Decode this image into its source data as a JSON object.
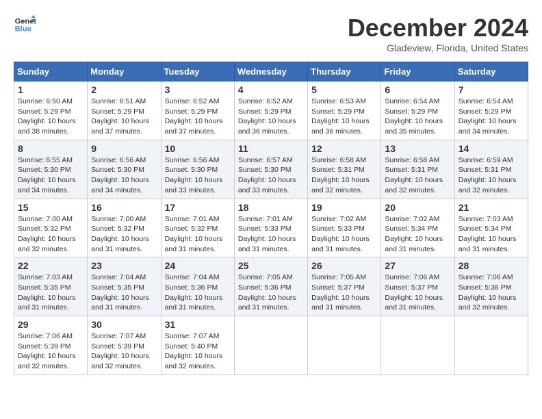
{
  "logo": {
    "line1": "General",
    "line2": "Blue"
  },
  "title": "December 2024",
  "location": "Gladeview, Florida, United States",
  "days_of_week": [
    "Sunday",
    "Monday",
    "Tuesday",
    "Wednesday",
    "Thursday",
    "Friday",
    "Saturday"
  ],
  "weeks": [
    [
      {
        "day": 1,
        "sunrise": "6:50 AM",
        "sunset": "5:29 PM",
        "daylight": "10 hours and 38 minutes."
      },
      {
        "day": 2,
        "sunrise": "6:51 AM",
        "sunset": "5:29 PM",
        "daylight": "10 hours and 37 minutes."
      },
      {
        "day": 3,
        "sunrise": "6:52 AM",
        "sunset": "5:29 PM",
        "daylight": "10 hours and 37 minutes."
      },
      {
        "day": 4,
        "sunrise": "6:52 AM",
        "sunset": "5:29 PM",
        "daylight": "10 hours and 36 minutes."
      },
      {
        "day": 5,
        "sunrise": "6:53 AM",
        "sunset": "5:29 PM",
        "daylight": "10 hours and 36 minutes."
      },
      {
        "day": 6,
        "sunrise": "6:54 AM",
        "sunset": "5:29 PM",
        "daylight": "10 hours and 35 minutes."
      },
      {
        "day": 7,
        "sunrise": "6:54 AM",
        "sunset": "5:29 PM",
        "daylight": "10 hours and 34 minutes."
      }
    ],
    [
      {
        "day": 8,
        "sunrise": "6:55 AM",
        "sunset": "5:30 PM",
        "daylight": "10 hours and 34 minutes."
      },
      {
        "day": 9,
        "sunrise": "6:56 AM",
        "sunset": "5:30 PM",
        "daylight": "10 hours and 34 minutes."
      },
      {
        "day": 10,
        "sunrise": "6:56 AM",
        "sunset": "5:30 PM",
        "daylight": "10 hours and 33 minutes."
      },
      {
        "day": 11,
        "sunrise": "6:57 AM",
        "sunset": "5:30 PM",
        "daylight": "10 hours and 33 minutes."
      },
      {
        "day": 12,
        "sunrise": "6:58 AM",
        "sunset": "5:31 PM",
        "daylight": "10 hours and 32 minutes."
      },
      {
        "day": 13,
        "sunrise": "6:58 AM",
        "sunset": "5:31 PM",
        "daylight": "10 hours and 32 minutes."
      },
      {
        "day": 14,
        "sunrise": "6:59 AM",
        "sunset": "5:31 PM",
        "daylight": "10 hours and 32 minutes."
      }
    ],
    [
      {
        "day": 15,
        "sunrise": "7:00 AM",
        "sunset": "5:32 PM",
        "daylight": "10 hours and 32 minutes."
      },
      {
        "day": 16,
        "sunrise": "7:00 AM",
        "sunset": "5:32 PM",
        "daylight": "10 hours and 31 minutes."
      },
      {
        "day": 17,
        "sunrise": "7:01 AM",
        "sunset": "5:32 PM",
        "daylight": "10 hours and 31 minutes."
      },
      {
        "day": 18,
        "sunrise": "7:01 AM",
        "sunset": "5:33 PM",
        "daylight": "10 hours and 31 minutes."
      },
      {
        "day": 19,
        "sunrise": "7:02 AM",
        "sunset": "5:33 PM",
        "daylight": "10 hours and 31 minutes."
      },
      {
        "day": 20,
        "sunrise": "7:02 AM",
        "sunset": "5:34 PM",
        "daylight": "10 hours and 31 minutes."
      },
      {
        "day": 21,
        "sunrise": "7:03 AM",
        "sunset": "5:34 PM",
        "daylight": "10 hours and 31 minutes."
      }
    ],
    [
      {
        "day": 22,
        "sunrise": "7:03 AM",
        "sunset": "5:35 PM",
        "daylight": "10 hours and 31 minutes."
      },
      {
        "day": 23,
        "sunrise": "7:04 AM",
        "sunset": "5:35 PM",
        "daylight": "10 hours and 31 minutes."
      },
      {
        "day": 24,
        "sunrise": "7:04 AM",
        "sunset": "5:36 PM",
        "daylight": "10 hours and 31 minutes."
      },
      {
        "day": 25,
        "sunrise": "7:05 AM",
        "sunset": "5:36 PM",
        "daylight": "10 hours and 31 minutes."
      },
      {
        "day": 26,
        "sunrise": "7:05 AM",
        "sunset": "5:37 PM",
        "daylight": "10 hours and 31 minutes."
      },
      {
        "day": 27,
        "sunrise": "7:06 AM",
        "sunset": "5:37 PM",
        "daylight": "10 hours and 31 minutes."
      },
      {
        "day": 28,
        "sunrise": "7:06 AM",
        "sunset": "5:38 PM",
        "daylight": "10 hours and 32 minutes."
      }
    ],
    [
      {
        "day": 29,
        "sunrise": "7:06 AM",
        "sunset": "5:39 PM",
        "daylight": "10 hours and 32 minutes."
      },
      {
        "day": 30,
        "sunrise": "7:07 AM",
        "sunset": "5:39 PM",
        "daylight": "10 hours and 32 minutes."
      },
      {
        "day": 31,
        "sunrise": "7:07 AM",
        "sunset": "5:40 PM",
        "daylight": "10 hours and 32 minutes."
      },
      null,
      null,
      null,
      null
    ]
  ]
}
